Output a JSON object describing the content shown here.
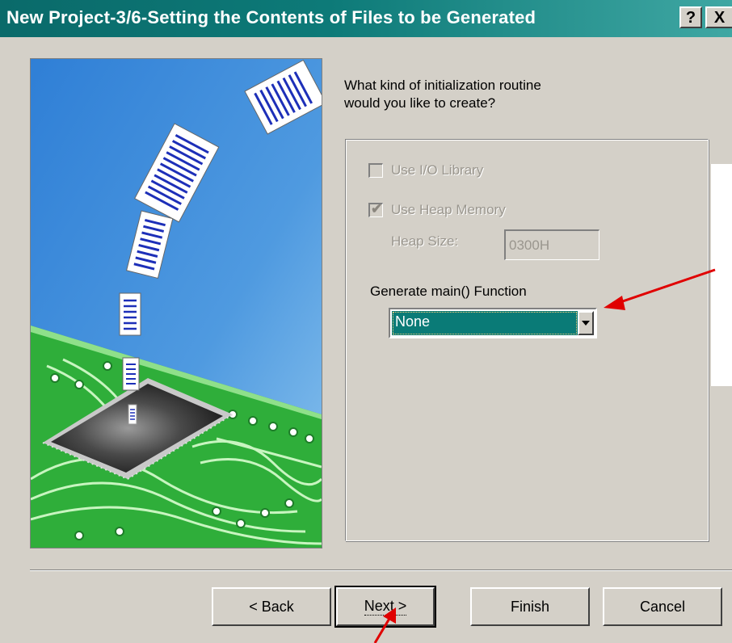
{
  "window": {
    "title": "New Project-3/6-Setting the Contents of Files to be Generated",
    "help_label": "?",
    "close_label": "X"
  },
  "prompt": {
    "line1": "What kind of initialization routine",
    "line2": "would you like to create?"
  },
  "options": {
    "use_io_library": {
      "label": "Use I/O Library",
      "checked": false,
      "enabled": false
    },
    "use_heap_memory": {
      "label": "Use Heap Memory",
      "checked": true,
      "enabled": false
    },
    "heap_size": {
      "label": "Heap Size:",
      "value": "0300H"
    }
  },
  "main_function": {
    "label": "Generate main() Function",
    "selected": "None"
  },
  "buttons": {
    "back": "< Back",
    "next": "Next >",
    "finish": "Finish",
    "cancel": "Cancel"
  },
  "colors": {
    "title_bar": "#0a6a6a",
    "selection": "#0a7b77",
    "annotation_arrow": "#e00000",
    "board_green": "#2fae3a"
  },
  "icons": [
    "help-icon",
    "close-icon",
    "checkbox-icon",
    "dropdown-arrow-icon",
    "annotation-arrow-icon"
  ]
}
